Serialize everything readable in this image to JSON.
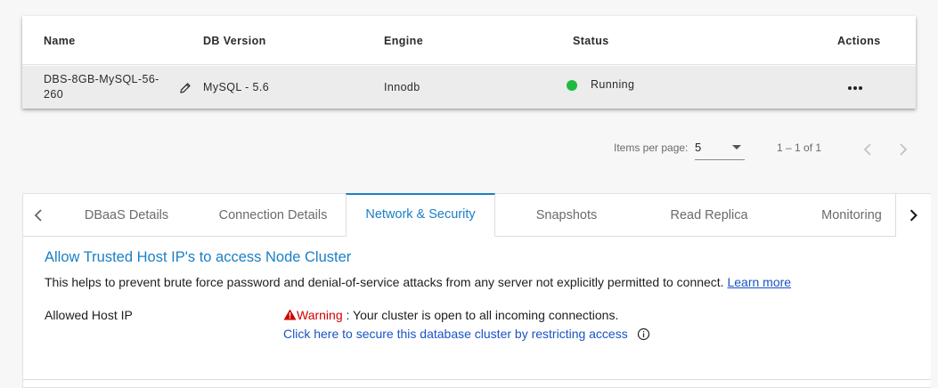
{
  "table": {
    "columns": [
      "Name",
      "DB Version",
      "Engine",
      "Status",
      "Actions"
    ],
    "rows": [
      {
        "name": "DBS-8GB-MySQL-56-260",
        "db_version": "MySQL - 5.6",
        "engine": "Innodb",
        "status": "Running",
        "status_color": "#1fba3f"
      }
    ]
  },
  "paginator": {
    "items_per_page_label": "Items per page:",
    "items_per_page_value": "5",
    "range_label": "1 – 1 of 1"
  },
  "tabs": [
    {
      "label": "DBaaS Details",
      "active": false
    },
    {
      "label": "Connection Details",
      "active": false
    },
    {
      "label": "Network & Security",
      "active": true
    },
    {
      "label": "Snapshots",
      "active": false
    },
    {
      "label": "Read Replica",
      "active": false
    },
    {
      "label": "Monitoring",
      "active": false
    }
  ],
  "security": {
    "title": "Allow Trusted Host IP's to access Node Cluster",
    "description": "This helps to prevent brute force password and denial-of-service attacks from any server not explicitly permitted to connect.",
    "learn_more": "Learn more",
    "allowed_host_label": "Allowed Host IP",
    "warning_word": "Warning",
    "warning_text": " : Your cluster is open to all incoming connections.",
    "secure_link": "Click here to secure this database cluster by restricting access"
  },
  "colors": {
    "accent": "#1a7fc6",
    "link": "#1a53c4",
    "warning": "#d10000",
    "running": "#1fba3f"
  },
  "icons": {
    "edit": "edit-pencil-icon",
    "actions": "more-horizontal-icon",
    "warning": "warning-triangle-icon",
    "info": "info-circle-icon"
  }
}
